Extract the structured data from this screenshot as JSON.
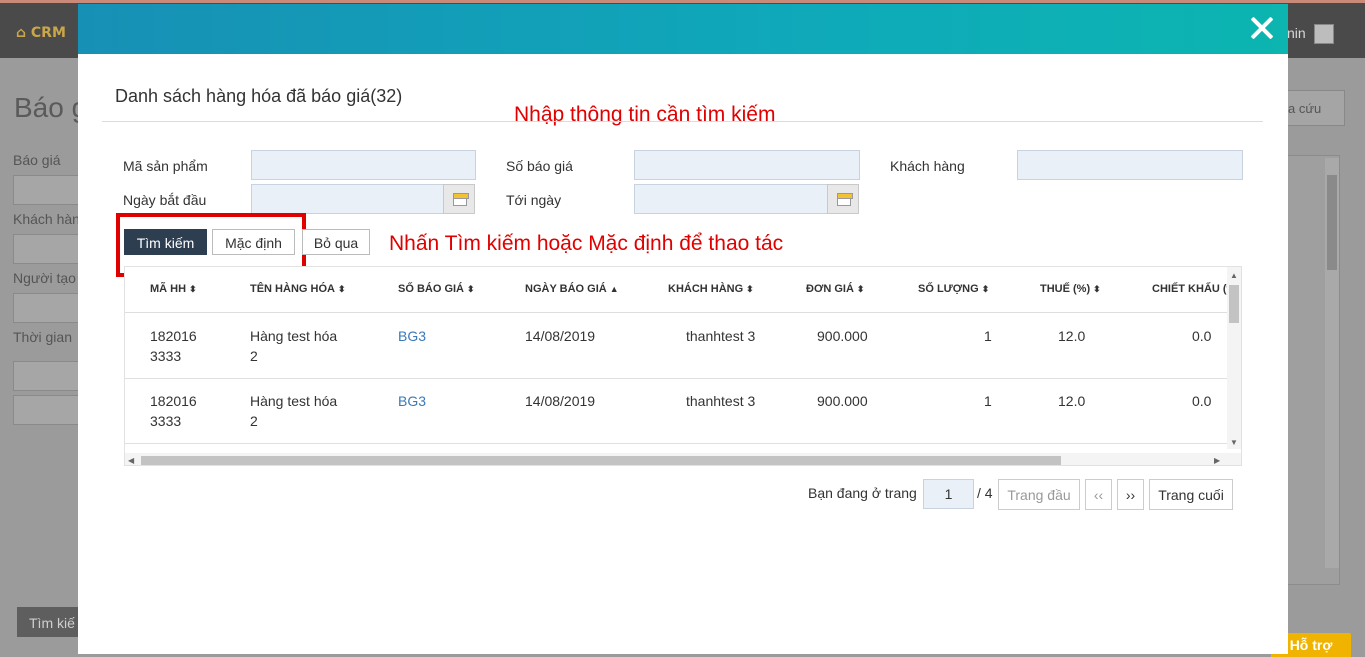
{
  "background": {
    "logo": "CRM",
    "user_text": "nin",
    "page_title": "Báo g",
    "labels": [
      "Báo giá",
      "Khách hàn",
      "Người tạo",
      "Thời gian"
    ],
    "lookup_button": "a cứu",
    "search_button": "Tìm kiế",
    "support_button": "Hỗ trợ"
  },
  "modal": {
    "title": "Danh sách hàng hóa đã báo giá(32)",
    "hint_top": "Nhập thông tin cần tìm kiếm",
    "hint_mid": "Nhấn Tìm kiếm hoặc Mặc định để thao tác",
    "filters": {
      "product_code_label": "Mã sản phẩm",
      "product_code_value": "",
      "quote_no_label": "Số báo giá",
      "quote_no_value": "",
      "customer_label": "Khách hàng",
      "customer_value": "",
      "start_date_label": "Ngày bắt đầu",
      "start_date_value": "",
      "end_date_label": "Tới ngày",
      "end_date_value": ""
    },
    "buttons": {
      "search": "Tìm kiếm",
      "default": "Mặc định",
      "skip": "Bỏ qua"
    },
    "table": {
      "columns": [
        "MÃ HH",
        "TÊN HÀNG HÓA",
        "SỐ BÁO GIÁ",
        "NGÀY BÁO GIÁ",
        "KHÁCH HÀNG",
        "ĐƠN GIÁ",
        "SỐ LƯỢNG",
        "THUẾ (%)",
        "CHIẾT KHẤU (%"
      ],
      "sort_icons": [
        "⬍",
        "⬍",
        "⬍",
        "▲",
        "⬍",
        "⬍",
        "⬍",
        "⬍"
      ],
      "rows": [
        {
          "code_1": "182016",
          "code_2": "3333",
          "name_1": "Hàng test hóa",
          "name_2": "2",
          "quote_no": "BG3",
          "date": "14/08/2019",
          "customer": "thanhtest 3",
          "price": "900.000",
          "qty": "1",
          "tax": "12.0",
          "discount": "0.0"
        },
        {
          "code_1": "182016",
          "code_2": "3333",
          "name_1": "Hàng test hóa",
          "name_2": "2",
          "quote_no": "BG3",
          "date": "14/08/2019",
          "customer": "thanhtest 3",
          "price": "900.000",
          "qty": "1",
          "tax": "12.0",
          "discount": "0.0"
        }
      ]
    },
    "pager": {
      "prefix": "Bạn đang ở trang",
      "current_page": "1",
      "total": "/ 4",
      "first": "Trang đầu",
      "prev": "‹‹",
      "next": "››",
      "last": "Trang cuối"
    }
  }
}
